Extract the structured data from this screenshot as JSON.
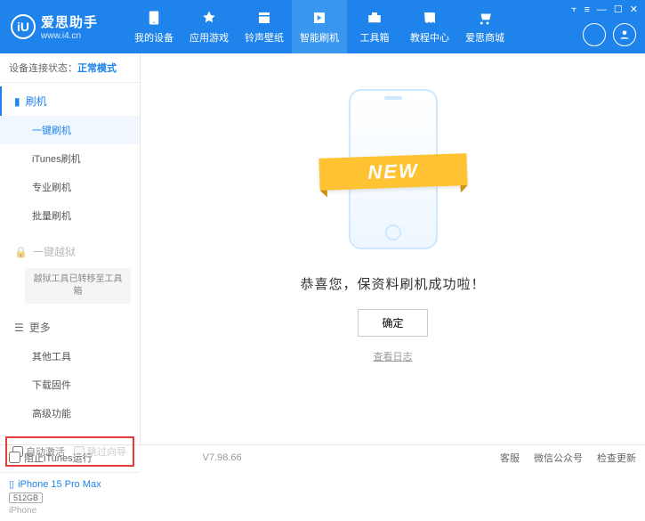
{
  "brand": {
    "name": "爱思助手",
    "url": "www.i4.cn",
    "logo_letter": "iU"
  },
  "nav": [
    {
      "label": "我的设备"
    },
    {
      "label": "应用游戏"
    },
    {
      "label": "铃声壁纸"
    },
    {
      "label": "智能刷机"
    },
    {
      "label": "工具箱"
    },
    {
      "label": "教程中心"
    },
    {
      "label": "爱思商城"
    }
  ],
  "status": {
    "label": "设备连接状态：",
    "mode": "正常模式"
  },
  "sidebar": {
    "flash_header": "刷机",
    "flash_items": [
      "一键刷机",
      "iTunes刷机",
      "专业刷机",
      "批量刷机"
    ],
    "jailbreak_header": "一键越狱",
    "jailbreak_note": "越狱工具已转移至工具箱",
    "more_header": "更多",
    "more_items": [
      "其他工具",
      "下载固件",
      "高级功能"
    ]
  },
  "checkboxes": {
    "auto_activate": "自动激活",
    "skip_guide": "跳过向导"
  },
  "device": {
    "name": "iPhone 15 Pro Max",
    "storage": "512GB",
    "type": "iPhone"
  },
  "main": {
    "ribbon": "NEW",
    "success": "恭喜您，保资料刷机成功啦！",
    "confirm": "确定",
    "view_log": "查看日志"
  },
  "footer": {
    "block_itunes": "阻止iTunes运行",
    "version": "V7.98.66",
    "links": [
      "客服",
      "微信公众号",
      "检查更新"
    ]
  }
}
